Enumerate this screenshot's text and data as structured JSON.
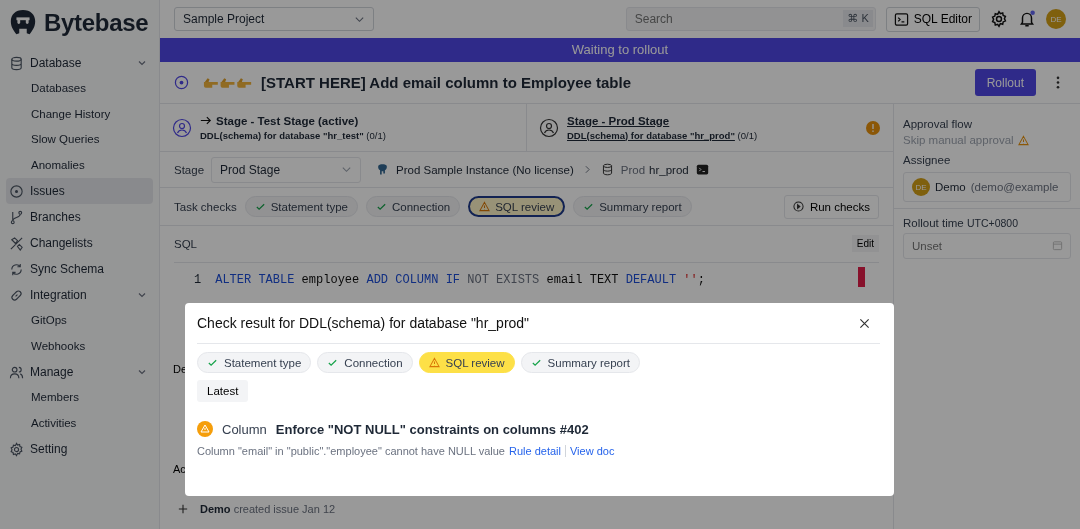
{
  "brand": {
    "name": "Bytebase"
  },
  "sidebar": {
    "items": [
      {
        "label": "Database",
        "expanded": true,
        "selected": false,
        "children": [
          {
            "label": "Databases",
            "selected": false
          },
          {
            "label": "Change History",
            "selected": false
          },
          {
            "label": "Slow Queries",
            "selected": false
          },
          {
            "label": "Anomalies",
            "selected": false
          }
        ]
      },
      {
        "label": "Issues",
        "selected": true
      },
      {
        "label": "Branches",
        "selected": false
      },
      {
        "label": "Changelists",
        "selected": false
      },
      {
        "label": "Sync Schema",
        "selected": false
      },
      {
        "label": "Integration",
        "expanded": true,
        "selected": false,
        "children": [
          {
            "label": "GitOps",
            "selected": false
          },
          {
            "label": "Webhooks",
            "selected": false
          }
        ]
      },
      {
        "label": "Manage",
        "expanded": true,
        "selected": false,
        "children": [
          {
            "label": "Members",
            "selected": false
          },
          {
            "label": "Activities",
            "selected": false
          }
        ]
      },
      {
        "label": "Setting",
        "selected": false
      }
    ]
  },
  "topbar": {
    "project": "Sample Project",
    "search": {
      "placeholder": "Search",
      "shortcut": "⌘ K"
    },
    "sql_editor": "SQL Editor",
    "avatar": "DE",
    "unread": true
  },
  "banner": "Waiting to rollout",
  "issue": {
    "title": "[START HERE] Add email column to Employee table",
    "rollout_button": "Rollout"
  },
  "stages": [
    {
      "title": "Stage - Test Stage (active)",
      "task": "DDL(schema) for database \"hr_test\"",
      "count": "(0/1)",
      "active": true,
      "selected": false,
      "warning": false
    },
    {
      "title": "Stage - Prod Stage",
      "task": "DDL(schema) for database \"hr_prod\"",
      "count": "(0/1)",
      "active": false,
      "selected": true,
      "warning": true
    }
  ],
  "stage_row": {
    "label": "Stage",
    "value": "Prod Stage",
    "instance": "Prod Sample Instance (No license)",
    "environment": "Prod",
    "database": "hr_prod"
  },
  "task_checks": {
    "label": "Task checks",
    "checks": [
      {
        "label": "Statement type",
        "kind": "success",
        "selected": false
      },
      {
        "label": "Connection",
        "kind": "success",
        "selected": false
      },
      {
        "label": "SQL review",
        "kind": "warning",
        "selected": true
      },
      {
        "label": "Summary report",
        "kind": "success",
        "selected": false
      }
    ],
    "run_button": "Run checks"
  },
  "sql": {
    "label": "SQL",
    "edit_button": "Edit",
    "line": "1",
    "tokens": [
      {
        "text": "ALTER TABLE",
        "kind": "keyword"
      },
      {
        "text": " employee ",
        "kind": "plain"
      },
      {
        "text": "ADD COLUMN IF",
        "kind": "keyword"
      },
      {
        "text": " NOT EXISTS",
        "kind": "dim"
      },
      {
        "text": " email TEXT ",
        "kind": "plain"
      },
      {
        "text": "DEFAULT",
        "kind": "keyword"
      },
      {
        "text": " ''",
        "kind": "string"
      },
      {
        "text": ";",
        "kind": "plain"
      }
    ]
  },
  "hidden_labels": [
    "De",
    "Ac"
  ],
  "activity": {
    "user": "Demo",
    "text": "created issue Jan 12"
  },
  "side_panel": {
    "approval_label": "Approval flow",
    "approval_value": "Skip manual approval",
    "assignee_label": "Assignee",
    "assignee_avatar": "DE",
    "assignee_name": "Demo",
    "assignee_email": "(demo@example",
    "rollout_label": "Rollout time",
    "rollout_tz": "UTC+0800",
    "rollout_placeholder": "Unset"
  },
  "modal": {
    "title": "Check result for DDL(schema) for database \"hr_prod\"",
    "checks": [
      {
        "label": "Statement type",
        "kind": "success",
        "selected": false
      },
      {
        "label": "Connection",
        "kind": "success",
        "selected": false
      },
      {
        "label": "SQL review",
        "kind": "warning",
        "selected": true
      },
      {
        "label": "Summary report",
        "kind": "success",
        "selected": false
      }
    ],
    "latest": "Latest",
    "result": {
      "kind": "warning",
      "category": "Column",
      "rule": "Enforce \"NOT NULL\" constraints on columns #402",
      "message": "Column \"email\" in \"public\".\"employee\" cannot have NULL value",
      "links": [
        "Rule detail",
        "View doc"
      ]
    }
  }
}
